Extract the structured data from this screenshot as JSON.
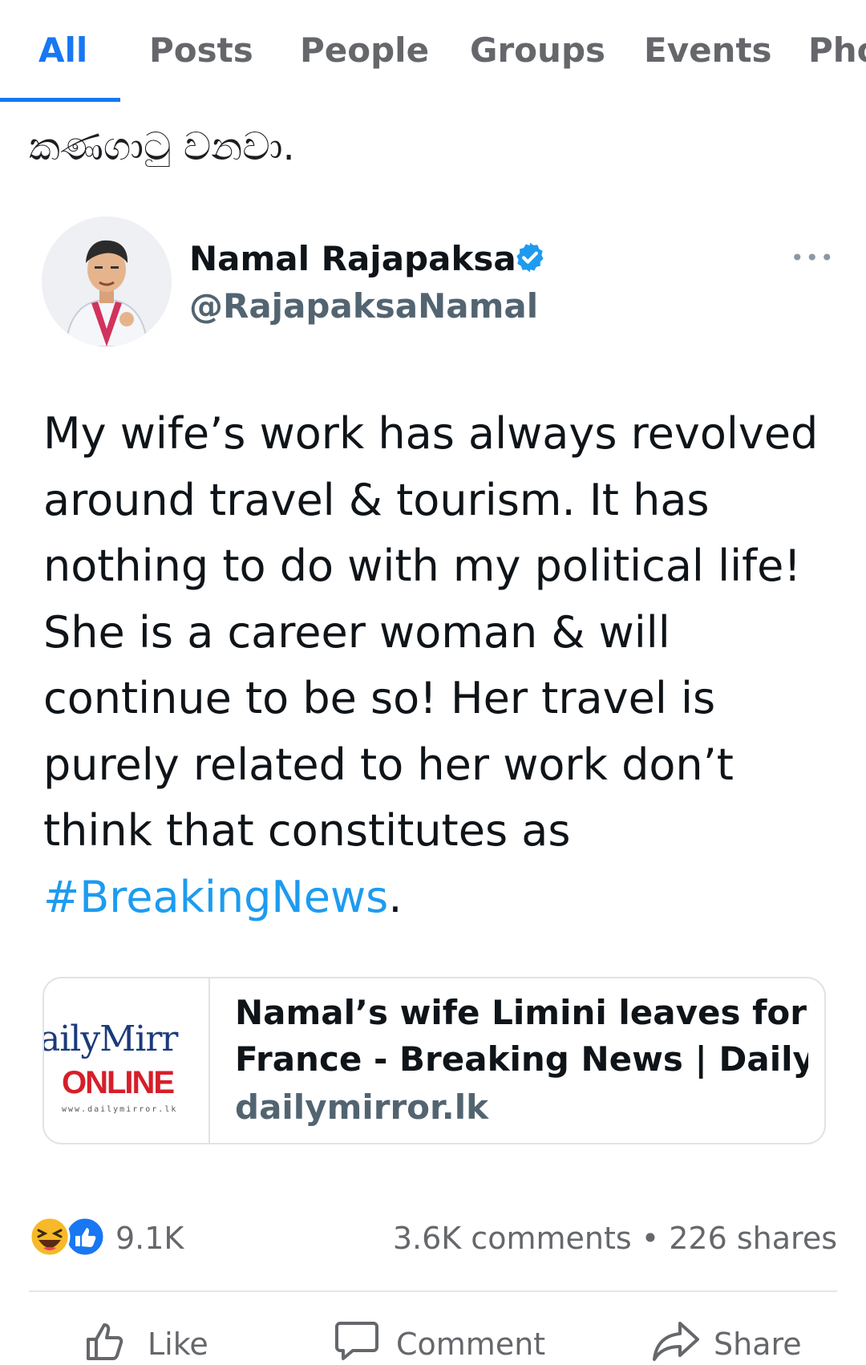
{
  "tabs": [
    {
      "label": "All",
      "active": true
    },
    {
      "label": "Posts"
    },
    {
      "label": "People"
    },
    {
      "label": "Groups"
    },
    {
      "label": "Events"
    },
    {
      "label": "Pho"
    }
  ],
  "post": {
    "text": "කණගාටු වනවා."
  },
  "tweet": {
    "author_name": "Namal Rajapaksa",
    "handle": "@RajapaksaNamal",
    "verified": true,
    "body": "My wife’s work has always revolved around travel & tourism. It has nothing to do with my political life! She is a career woman & will continue to be so! Her travel is purely related to her work don’t think that constitutes as",
    "hashtag": "#BreakingNews",
    "body_end": ".",
    "link": {
      "thumb_line1": "ailyMirr",
      "thumb_line2": "ONLINE",
      "thumb_line3": "www.dailymirror.lk",
      "title_line1": "Namal’s wife Limini leaves for",
      "title_line2": "France - Breaking News | Daily...",
      "domain": "dailymirror.lk"
    }
  },
  "engagement": {
    "reaction_count": "9.1K",
    "comments": "3.6K comments",
    "separator": "•",
    "shares": "226 shares"
  },
  "actions": {
    "like": "Like",
    "comment": "Comment",
    "share": "Share"
  },
  "colors": {
    "accent": "#1877f2",
    "hashtag": "#1d9bf0",
    "muted": "#65676b"
  }
}
